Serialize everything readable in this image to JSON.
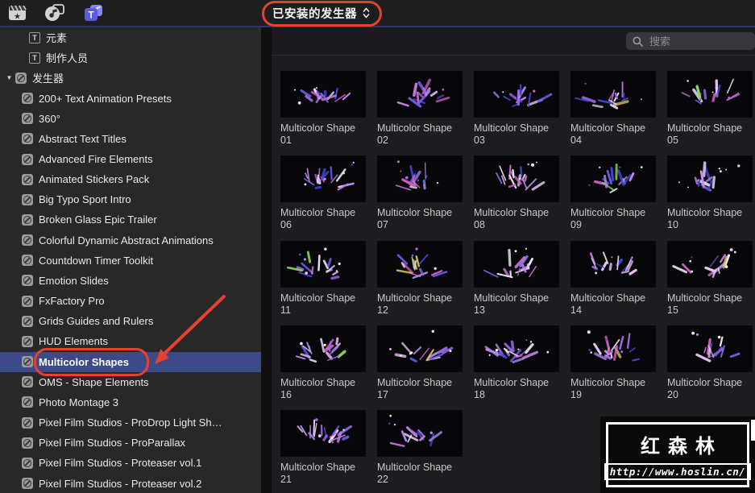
{
  "toolbar": {
    "icons": [
      {
        "name": "media-clapperboard-icon"
      },
      {
        "name": "photos-audio-icon"
      },
      {
        "name": "titles-generators-icon",
        "active": true
      }
    ],
    "dropdown": {
      "label": "已安装的发生器"
    }
  },
  "search": {
    "placeholder": "搜索"
  },
  "sidebar": {
    "items": [
      {
        "label": "元素",
        "type": "top",
        "icon": "t"
      },
      {
        "label": "制作人员",
        "type": "top",
        "icon": "t"
      },
      {
        "label": "发生器",
        "type": "group",
        "icon": "gen",
        "expanded": true
      },
      {
        "label": "200+ Text Animation Presets",
        "type": "child",
        "icon": "gen"
      },
      {
        "label": "360°",
        "type": "child",
        "icon": "gen"
      },
      {
        "label": "Abstract Text Titles",
        "type": "child",
        "icon": "gen"
      },
      {
        "label": "Advanced Fire Elements",
        "type": "child",
        "icon": "gen"
      },
      {
        "label": "Animated Stickers Pack",
        "type": "child",
        "icon": "gen"
      },
      {
        "label": "Big Typo Sport Intro",
        "type": "child",
        "icon": "gen"
      },
      {
        "label": "Broken Glass Epic Trailer",
        "type": "child",
        "icon": "gen"
      },
      {
        "label": "Colorful Dynamic Abstract Animations",
        "type": "child",
        "icon": "gen"
      },
      {
        "label": "Countdown Timer Toolkit",
        "type": "child",
        "icon": "gen"
      },
      {
        "label": "Emotion Slides",
        "type": "child",
        "icon": "gen"
      },
      {
        "label": "FxFactory Pro",
        "type": "child",
        "icon": "gen"
      },
      {
        "label": "Grids Guides and Rulers",
        "type": "child",
        "icon": "gen"
      },
      {
        "label": "HUD Elements",
        "type": "child",
        "icon": "gen"
      },
      {
        "label": "Multicolor Shapes",
        "type": "child",
        "icon": "gen",
        "selected": true
      },
      {
        "label": "OMS - Shape Elements",
        "type": "child",
        "icon": "gen"
      },
      {
        "label": "Photo Montage 3",
        "type": "child",
        "icon": "gen"
      },
      {
        "label": "Pixel Film Studios - ProDrop Light Sh…",
        "type": "child",
        "icon": "gen"
      },
      {
        "label": "Pixel Film Studios - ProParallax",
        "type": "child",
        "icon": "gen"
      },
      {
        "label": "Pixel Film Studios - Proteaser vol.1",
        "type": "child",
        "icon": "gen"
      },
      {
        "label": "Pixel Film Studios - Proteaser vol.2",
        "type": "child",
        "icon": "gen"
      }
    ]
  },
  "grid": {
    "items": [
      {
        "label": "Multicolor Shape",
        "num": "01"
      },
      {
        "label": "Multicolor Shape",
        "num": "02"
      },
      {
        "label": "Multicolor Shape",
        "num": "03"
      },
      {
        "label": "Multicolor Shape",
        "num": "04"
      },
      {
        "label": "Multicolor Shape",
        "num": "05"
      },
      {
        "label": "Multicolor Shape",
        "num": "06"
      },
      {
        "label": "Multicolor Shape",
        "num": "07"
      },
      {
        "label": "Multicolor Shape",
        "num": "08"
      },
      {
        "label": "Multicolor Shape",
        "num": "09"
      },
      {
        "label": "Multicolor Shape",
        "num": "10"
      },
      {
        "label": "Multicolor Shape",
        "num": "11"
      },
      {
        "label": "Multicolor Shape",
        "num": "12"
      },
      {
        "label": "Multicolor Shape",
        "num": "13"
      },
      {
        "label": "Multicolor Shape",
        "num": "14"
      },
      {
        "label": "Multicolor Shape",
        "num": "15"
      },
      {
        "label": "Multicolor Shape",
        "num": "16"
      },
      {
        "label": "Multicolor Shape",
        "num": "17"
      },
      {
        "label": "Multicolor Shape",
        "num": "18"
      },
      {
        "label": "Multicolor Shape",
        "num": "19"
      },
      {
        "label": "Multicolor Shape",
        "num": "20"
      },
      {
        "label": "Multicolor Shape",
        "num": "21"
      },
      {
        "label": "Multicolor Shape",
        "num": "22"
      }
    ]
  },
  "watermark": {
    "title": "红森林",
    "url": "http://www.hoslin.cn/"
  },
  "colors": {
    "selected_row": "#3c4a88",
    "annotation_red": "#e8402e",
    "active_icon_blue": "#5b5be2",
    "thumb_palette": [
      "#6f5ae8",
      "#9a6ae8",
      "#c77fe8",
      "#e8c7f2",
      "#4646d8",
      "#d45fc8",
      "#efe6f8",
      "#b08ae8",
      "#8cd85a",
      "#d8c85a"
    ]
  }
}
